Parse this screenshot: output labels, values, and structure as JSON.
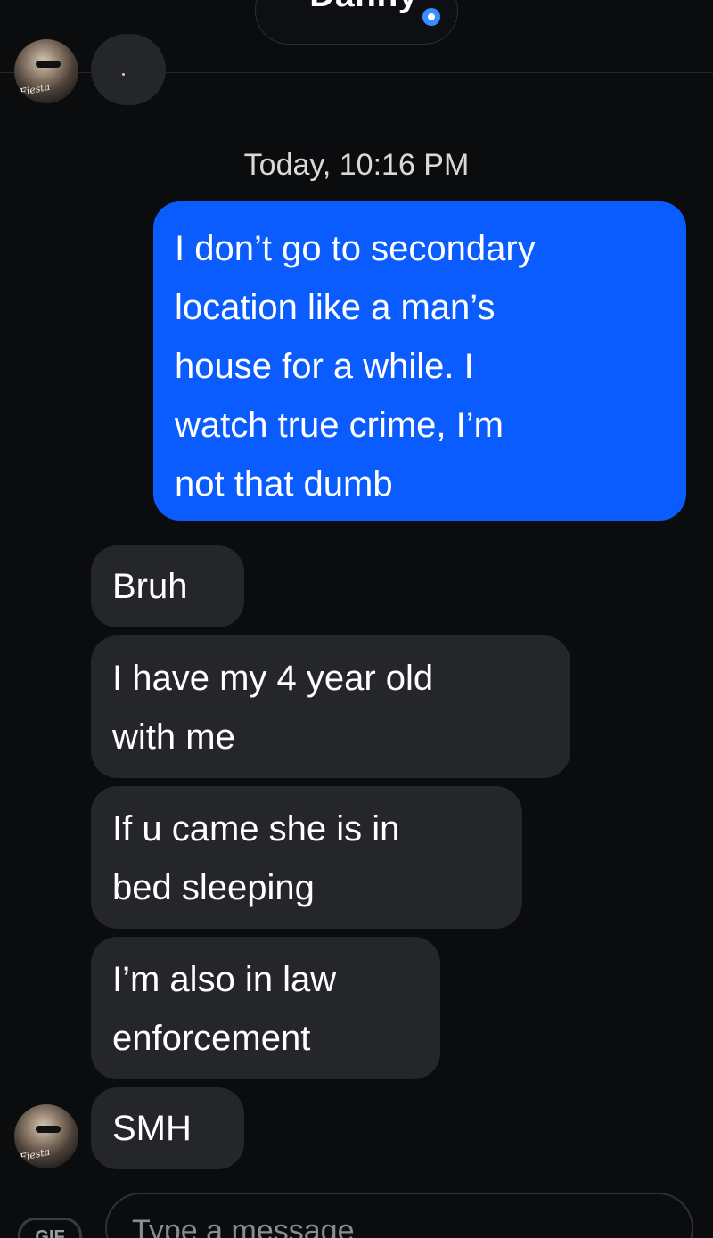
{
  "header": {
    "contact_name": "Danny",
    "verified_icon": "verified-badge-icon"
  },
  "conversation": {
    "timestamp": "Today, 10:16 PM",
    "top_partial_message": "·",
    "sent_message": "I don’t go to secondary\nlocation like a man’s\nhouse for a while. I\nwatch true crime, I’m\nnot that dumb",
    "received_messages": [
      "Bruh",
      "I have my 4 year old\nwith me",
      "If u came she is in\nbed sleeping",
      "I’m also in law\nenforcement",
      "SMH"
    ],
    "avatar_signature": "Fiesta"
  },
  "composer": {
    "gif_label": "GIF",
    "placeholder": "Type a message"
  },
  "colors": {
    "background": "#0b0c0e",
    "sent_bubble": "#0a5cff",
    "received_bubble": "#25262a",
    "verified": "#3a8dff"
  }
}
